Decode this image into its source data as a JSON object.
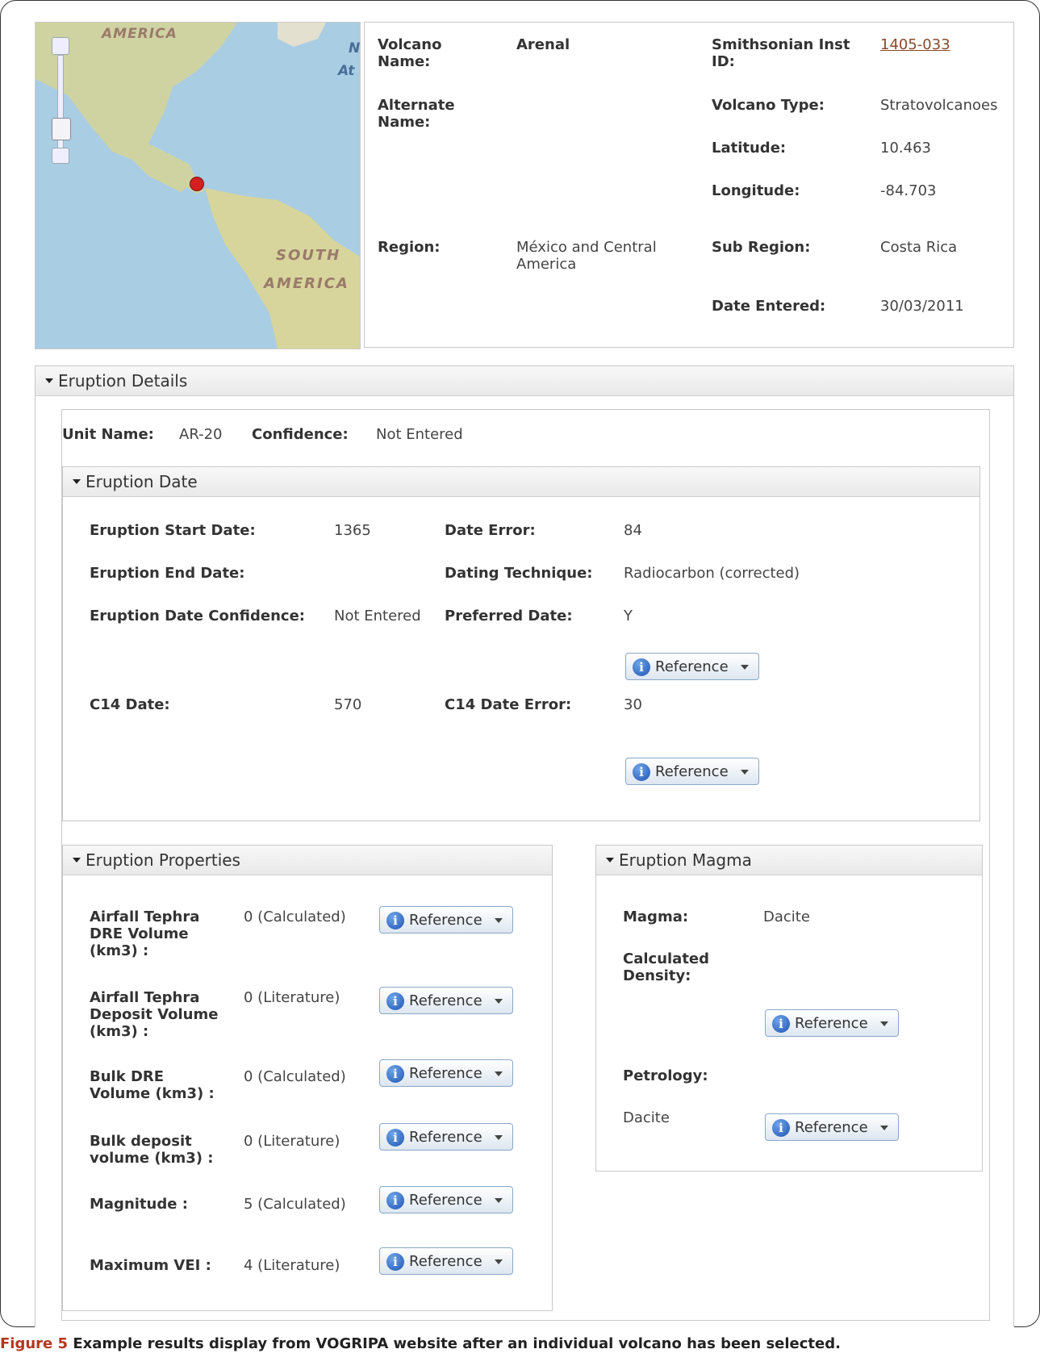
{
  "volcano": {
    "name_label": "Volcano Name:",
    "name": "Arenal",
    "smithsonian_label": "Smithsonian Inst ID:",
    "smithsonian_id": "1405-033",
    "alternate_label": "Alternate Name:",
    "type_label": "Volcano Type:",
    "type": "Stratovolcanoes",
    "latitude_label": "Latitude:",
    "latitude": "10.463",
    "longitude_label": "Longitude:",
    "longitude": "-84.703",
    "region_label": "Region:",
    "region": "México and Central America",
    "subregion_label": "Sub Region:",
    "subregion": "Costa Rica",
    "date_entered_label": "Date Entered:",
    "date_entered": "30/03/2011"
  },
  "map": {
    "label_america": "AMERICA",
    "label_south1": "SOUTH",
    "label_south2": "AMERICA",
    "label_atl1": "N",
    "label_atl2": "At",
    "water_color": "#a9cde3",
    "land_color": "#d9dba6",
    "marker_color": "#d62020"
  },
  "eruption_details": {
    "title": "Eruption Details",
    "unit_label": "Unit Name:",
    "unit": "AR-20",
    "confidence_label": "Confidence:",
    "confidence": "Not Entered"
  },
  "eruption_date": {
    "title": "Eruption Date",
    "start_label": "Eruption Start Date:",
    "start": "1365",
    "error_label": "Date Error:",
    "error": "84",
    "end_label": "Eruption End Date:",
    "technique_label": "Dating Technique:",
    "technique": "Radiocarbon (corrected)",
    "conf_label": "Eruption Date Confidence:",
    "conf": "Not Entered",
    "preferred_label": "Preferred Date:",
    "preferred": "Y",
    "c14_label": "C14 Date:",
    "c14": "570",
    "c14_error_label": "C14 Date Error:",
    "c14_error": "30"
  },
  "reference_label": "Reference",
  "eruption_properties": {
    "title": "Eruption Properties",
    "rows": [
      {
        "label": "Airfall Tephra DRE Volume (km3) :",
        "value": "0 (Calculated)"
      },
      {
        "label": "Airfall Tephra Deposit Volume (km3) :",
        "value": "0 (Literature)"
      },
      {
        "label": "Bulk DRE Volume (km3) :",
        "value": "0 (Calculated)"
      },
      {
        "label": "Bulk deposit volume (km3) :",
        "value": "0 (Literature)"
      },
      {
        "label": "Magnitude :",
        "value": "5 (Calculated)"
      },
      {
        "label": "Maximum VEI :",
        "value": "4 (Literature)"
      }
    ]
  },
  "eruption_magma": {
    "title": "Eruption Magma",
    "magma_label": "Magma:",
    "magma": "Dacite",
    "density_label": "Calculated Density:",
    "petrology_label": "Petrology:",
    "petrology": "Dacite"
  },
  "caption": {
    "figure": "Figure 5",
    "text": " Example results display from VOGRIPA website after an individual volcano has been selected."
  }
}
